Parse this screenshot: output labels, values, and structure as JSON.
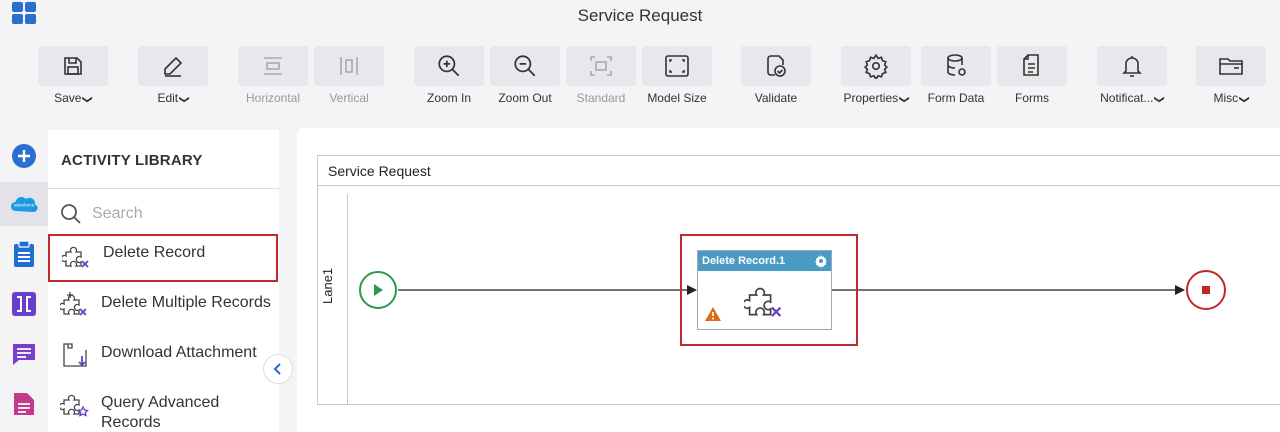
{
  "header": {
    "title": "Service Request"
  },
  "toolbar": {
    "items": [
      {
        "label": "Save",
        "has_menu": true,
        "disabled": false,
        "icon": "save-icon"
      },
      {
        "label": "Edit",
        "has_menu": true,
        "disabled": false,
        "icon": "edit-icon"
      },
      {
        "label": "Horizontal",
        "has_menu": false,
        "disabled": true,
        "icon": "horizontal-icon"
      },
      {
        "label": "Vertical",
        "has_menu": false,
        "disabled": true,
        "icon": "vertical-icon"
      },
      {
        "label": "Zoom In",
        "has_menu": false,
        "disabled": false,
        "icon": "zoom-in-icon"
      },
      {
        "label": "Zoom Out",
        "has_menu": false,
        "disabled": false,
        "icon": "zoom-out-icon"
      },
      {
        "label": "Standard",
        "has_menu": false,
        "disabled": true,
        "icon": "standard-icon"
      },
      {
        "label": "Model Size",
        "has_menu": false,
        "disabled": false,
        "icon": "model-size-icon"
      },
      {
        "label": "Validate",
        "has_menu": false,
        "disabled": false,
        "icon": "validate-icon"
      },
      {
        "label": "Properties",
        "has_menu": true,
        "disabled": false,
        "icon": "gear-icon"
      },
      {
        "label": "Form Data",
        "has_menu": false,
        "disabled": false,
        "icon": "database-icon"
      },
      {
        "label": "Forms",
        "has_menu": false,
        "disabled": false,
        "icon": "forms-icon"
      },
      {
        "label": "Notificat...",
        "has_menu": true,
        "disabled": false,
        "icon": "bell-icon"
      },
      {
        "label": "Misc",
        "has_menu": true,
        "disabled": false,
        "icon": "folder-icon"
      }
    ]
  },
  "rail": {
    "items": [
      "add-icon",
      "salesforce-icon",
      "clipboard-icon",
      "bracket-icon",
      "chat-icon",
      "document-icon"
    ],
    "salesforce_text": "salesforce"
  },
  "library": {
    "title": "ACTIVITY LIBRARY",
    "search_placeholder": "Search",
    "items": [
      {
        "label": "Delete Record",
        "selected": true
      },
      {
        "label": "Delete Multiple Records",
        "selected": false
      },
      {
        "label": "Download Attachment",
        "selected": false
      },
      {
        "label": "Query Advanced Records",
        "selected": false
      }
    ]
  },
  "canvas": {
    "pool_title": "Service Request",
    "lane_label": "Lane1",
    "activity": {
      "title": "Delete Record.1",
      "has_warning": true
    }
  },
  "colors": {
    "accent": "#2a6fcf",
    "selection": "#c0292b",
    "activity_header": "#4a9bc4",
    "start_event": "#2e9a4a",
    "end_event": "#c0292b",
    "puzzle_purple": "#6a3fc8",
    "warning": "#e06a1a"
  }
}
